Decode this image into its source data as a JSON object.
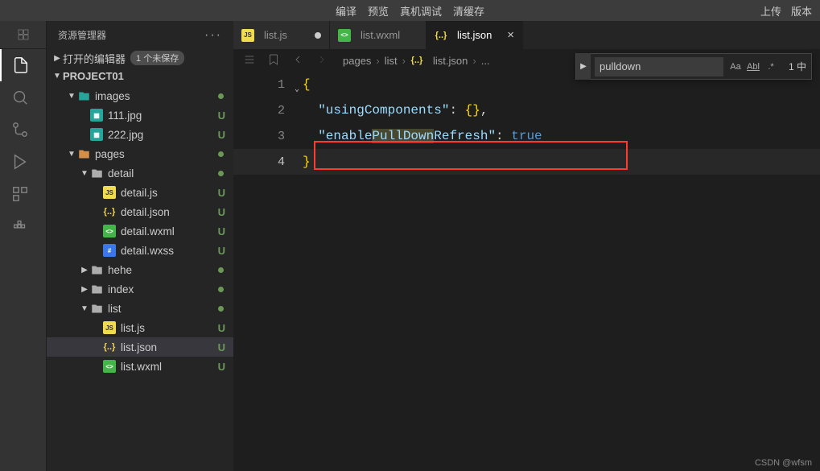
{
  "topmenu": {
    "items": [
      "编译",
      "预览",
      "真机调试",
      "清缓存"
    ],
    "right": [
      "上传",
      "版本"
    ]
  },
  "sidebar": {
    "title": "资源管理器",
    "openEditorsLabel": "打开的编辑器",
    "unsavedBadge": "1 个未保存",
    "projectName": "PROJECT01"
  },
  "tree": [
    {
      "depth": 1,
      "type": "folder-teal",
      "name": "images",
      "expanded": true,
      "dot": true
    },
    {
      "depth": 2,
      "type": "img",
      "name": "111.jpg",
      "status": "U"
    },
    {
      "depth": 2,
      "type": "img",
      "name": "222.jpg",
      "status": "U"
    },
    {
      "depth": 1,
      "type": "folder-orange",
      "name": "pages",
      "expanded": true,
      "dot": true
    },
    {
      "depth": 2,
      "type": "folder-grey",
      "name": "detail",
      "expanded": true,
      "dot": true
    },
    {
      "depth": 3,
      "type": "js",
      "name": "detail.js",
      "status": "U"
    },
    {
      "depth": 3,
      "type": "json",
      "name": "detail.json",
      "status": "U"
    },
    {
      "depth": 3,
      "type": "wxml",
      "name": "detail.wxml",
      "status": "U"
    },
    {
      "depth": 3,
      "type": "wxss",
      "name": "detail.wxss",
      "status": "U"
    },
    {
      "depth": 2,
      "type": "folder-grey",
      "name": "hehe",
      "expanded": false,
      "dot": true
    },
    {
      "depth": 2,
      "type": "folder-grey",
      "name": "index",
      "expanded": false,
      "dot": true
    },
    {
      "depth": 2,
      "type": "folder-grey",
      "name": "list",
      "expanded": true,
      "dot": true
    },
    {
      "depth": 3,
      "type": "js",
      "name": "list.js",
      "status": "U"
    },
    {
      "depth": 3,
      "type": "json",
      "name": "list.json",
      "status": "U",
      "active": true
    },
    {
      "depth": 3,
      "type": "wxml",
      "name": "list.wxml",
      "status": "U"
    }
  ],
  "tabs": [
    {
      "icon": "js",
      "label": "list.js",
      "dirty": true
    },
    {
      "icon": "wxml",
      "label": "list.wxml"
    },
    {
      "icon": "json",
      "label": "list.json",
      "active": true,
      "close": true
    }
  ],
  "breadcrumb": [
    "pages",
    "list",
    "list.json",
    "..."
  ],
  "code": {
    "lines": [
      {
        "n": "1",
        "html": "<span class='tok-brace'>{</span>",
        "fold": true
      },
      {
        "n": "2",
        "html": "  <span class='tok-key'>\"usingComponents\"</span><span class='tok-punc'>: </span><span class='tok-brace'>{}</span><span class='tok-punc'>,</span>"
      },
      {
        "n": "3",
        "html": "  <span class='tok-key'>\"enable<span class='hlsearch'>PullDown</span>Refresh\"</span><span class='tok-punc'>: </span><span class='tok-bool'>true</span>"
      },
      {
        "n": "4",
        "html": "<span class='tok-brace'>}</span>",
        "current": true
      }
    ]
  },
  "find": {
    "value": "pulldown",
    "countLabel": "1 中",
    "opts": {
      "case": "Aa",
      "word": "Abl",
      "regex": ".*"
    }
  },
  "watermark": "CSDN @wfsm"
}
